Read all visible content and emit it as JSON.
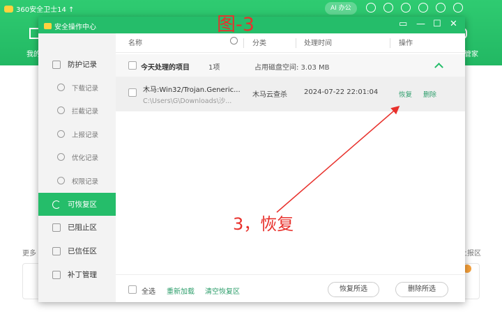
{
  "app": {
    "title": "360安全卫士14 ↑",
    "ai_pill": "AI 办公",
    "left_partial": "我的",
    "right_partial": "管家",
    "behind_left": "更多",
    "behind_right": "上报区"
  },
  "annotations": {
    "figure": "图-3",
    "step": "3，恢复"
  },
  "dialog": {
    "title": "安全操作中心",
    "controls": {
      "menu": "▭",
      "min": "—",
      "max": "☐",
      "close": "✕"
    }
  },
  "sidebar": {
    "items": [
      {
        "label": "防护记录",
        "icon": "edit-icon"
      },
      {
        "label": "下载记录",
        "icon": "download-icon"
      },
      {
        "label": "拦截记录",
        "icon": "block-icon"
      },
      {
        "label": "上报记录",
        "icon": "upload-icon"
      },
      {
        "label": "优化记录",
        "icon": "optimize-icon"
      },
      {
        "label": "权限记录",
        "icon": "permission-icon"
      },
      {
        "label": "可恢复区",
        "icon": "restore-icon"
      },
      {
        "label": "已阻止区",
        "icon": "shield-icon"
      },
      {
        "label": "已信任区",
        "icon": "trust-icon"
      },
      {
        "label": "补丁管理",
        "icon": "patch-icon"
      }
    ],
    "active": "可恢复区"
  },
  "table": {
    "headers": {
      "name": "名称",
      "category": "分类",
      "time": "处理时间",
      "action": "操作"
    },
    "group": {
      "label": "今天处理的项目",
      "count": "1项",
      "disk": "占用磁盘空间: 3.03 MB"
    },
    "rows": [
      {
        "name": "木马:Win32/Trojan.Generic...",
        "path": "C:\\Users\\G\\Downloads\\沙...",
        "category": "木马云查杀",
        "time": "2024-07-22 22:01:04",
        "restore": "恢复",
        "delete": "删除"
      }
    ]
  },
  "footer": {
    "select_all": "全选",
    "reload": "重新加载",
    "clear": "清空恢复区",
    "restore_selected": "恢复所选",
    "delete_selected": "删除所选"
  }
}
